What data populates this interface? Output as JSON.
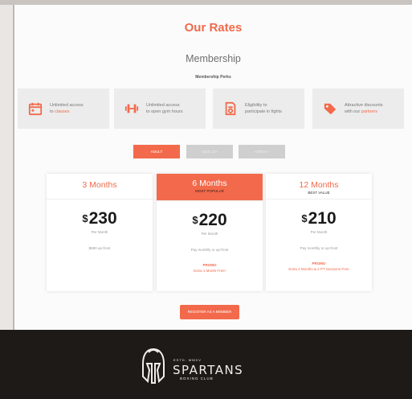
{
  "page": {
    "title": "Our Rates",
    "membership_heading": "Membership",
    "perks_label": "Membership Perks"
  },
  "perks": [
    {
      "icon": "calendar-icon",
      "text": "Unlimited access",
      "text2_plain": "to ",
      "text2_hl": "classes"
    },
    {
      "icon": "dumbbell-icon",
      "text": "Unlimited access",
      "text2_plain": "to open gym hours",
      "text2_hl": ""
    },
    {
      "icon": "certificate-icon",
      "text": "Eligibility to",
      "text2_plain": "participate in fights",
      "text2_hl": ""
    },
    {
      "icon": "tag-icon",
      "text": "Attractive discounts",
      "text2_plain": "with our ",
      "text2_hl": "partners"
    }
  ],
  "tabs": [
    "ADULT",
    "KIDS 13+",
    "KIDS 5+"
  ],
  "plans": [
    {
      "name": "3 Months",
      "badge": "",
      "currency": "$",
      "amount": "230",
      "per": "Per Month",
      "pay": "$690 up-front",
      "promo": "",
      "promo_sub": ""
    },
    {
      "name": "6 Months",
      "badge": "MOST POPULAR",
      "currency": "$",
      "amount": "220",
      "per": "Per Month",
      "pay": "Pay monthly or up-front",
      "promo": "PROMO",
      "promo_sub": "Extra 1 Month Free!"
    },
    {
      "name": "12 Months",
      "badge": "BEST VALUE",
      "currency": "$",
      "amount": "210",
      "per": "Per Month",
      "pay": "Pay monthly or up-front",
      "promo": "PROMO",
      "promo_sub": "Extra 2 Months & 2 PT Sessions Free"
    }
  ],
  "cta": {
    "label": "REGISTER AS A MEMBER"
  },
  "footer": {
    "est": "ESTD. MMXV",
    "brand": "SPARTANS",
    "sub": "BOXING CLUB"
  },
  "colors": {
    "accent": "#f26a4b",
    "footer_bg": "#1e1a18"
  }
}
